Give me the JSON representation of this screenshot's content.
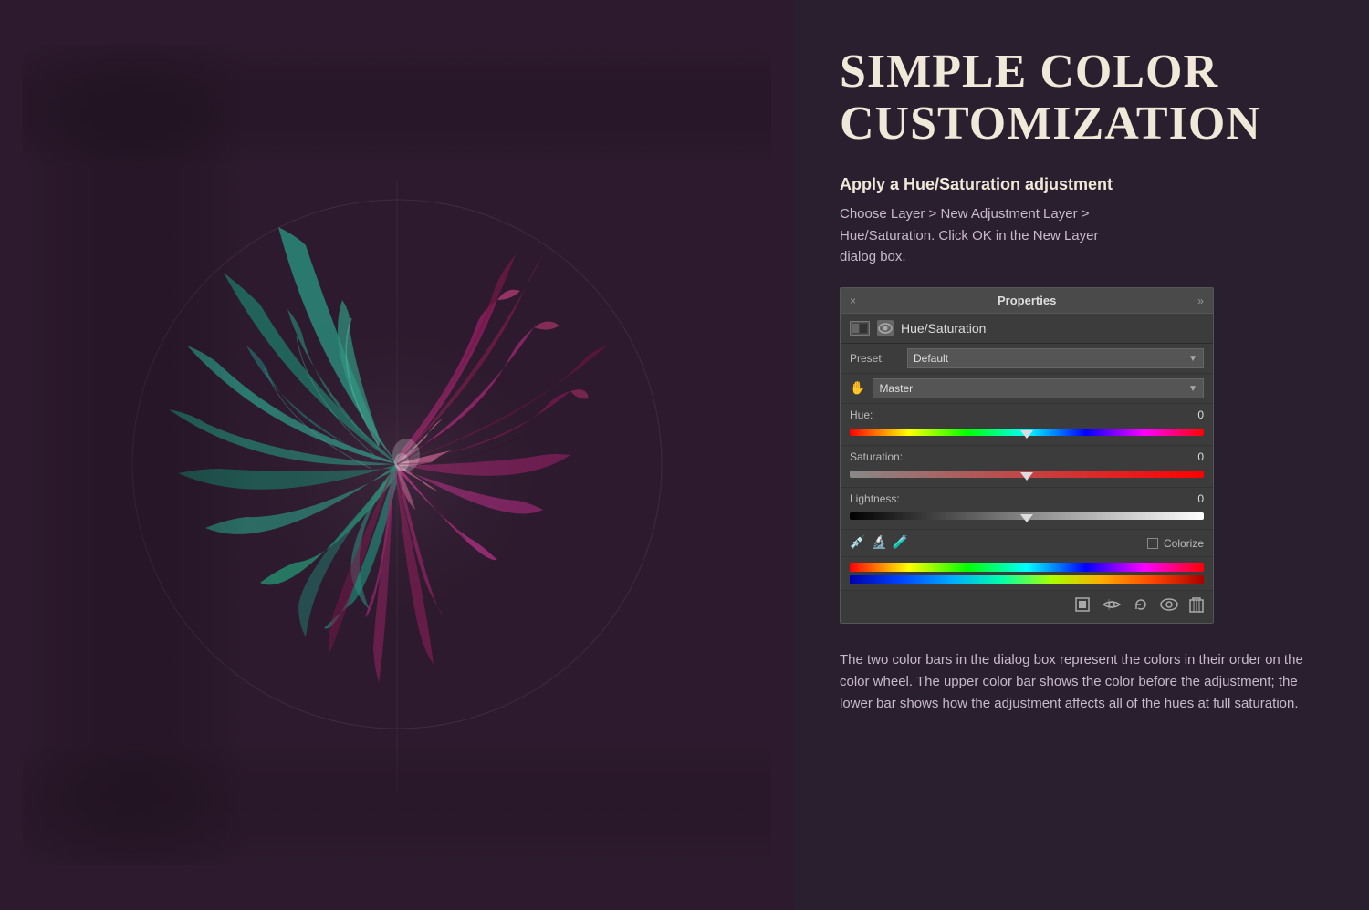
{
  "left": {
    "bg_color": "#2d1a2e"
  },
  "right": {
    "bg_color": "#2a1f2e",
    "main_title": "SIMPLE COLOR\nCUSTOMIZATION",
    "subtitle": "Apply a Hue/Saturation adjustment",
    "description": "Choose Layer > New Adjustment Layer >\nHue/Saturation. Click OK in the New Layer\ndialog box.",
    "description_note": "The two color bars in the dialog box represent the colors in their order on the color wheel. The upper color bar shows the color before the adjustment; the lower bar shows how the adjustment affects all of the hues at full saturation."
  },
  "properties_panel": {
    "title": "Properties",
    "layer_name": "Hue/Saturation",
    "preset_label": "Preset:",
    "preset_value": "Default",
    "channel_value": "Master",
    "hue_label": "Hue:",
    "hue_value": "0",
    "saturation_label": "Saturation:",
    "saturation_value": "0",
    "lightness_label": "Lightness:",
    "lightness_value": "0",
    "colorize_label": "Colorize",
    "close_btn": "×",
    "arrows_btn": "»"
  },
  "menu_items": {
    "choose_layer": "Choose Layer",
    "new_adjustment_layer": "New Adjustment Layer"
  }
}
